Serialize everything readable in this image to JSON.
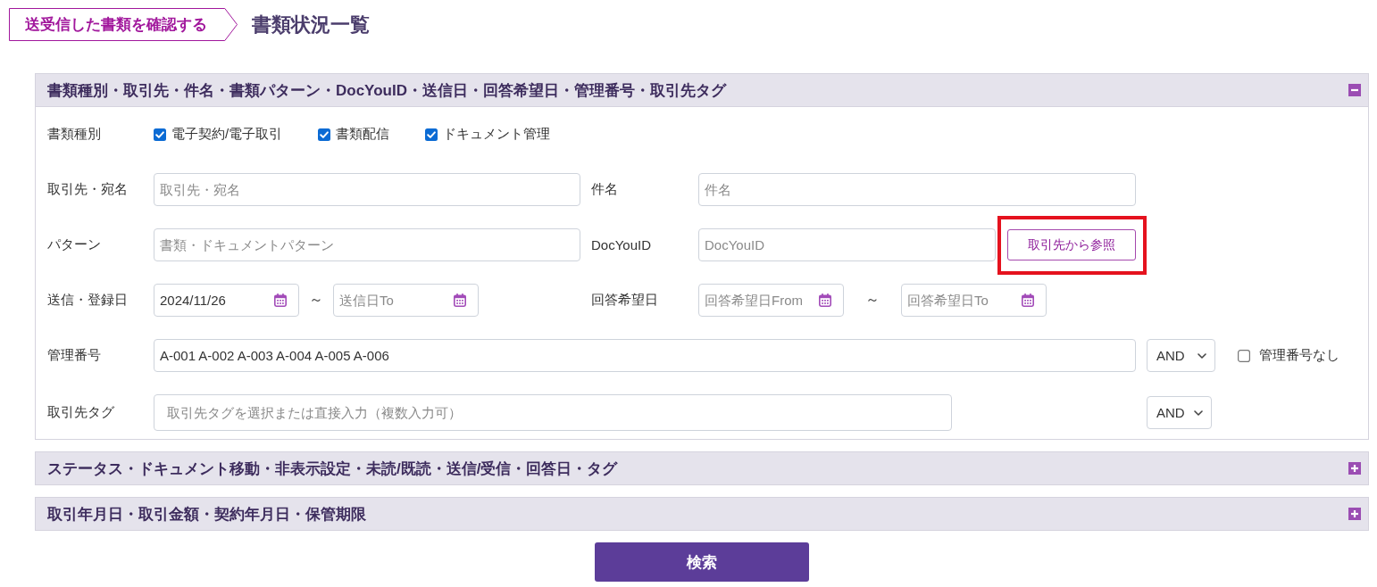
{
  "breadcrumb": {
    "link": "送受信した書類を確認する",
    "title": "書類状況一覧"
  },
  "sections": [
    {
      "title": "書類種別・取引先・件名・書類パターン・DocYouID・送信日・回答希望日・管理番号・取引先タグ",
      "expanded": true,
      "rows": [
        {
          "kind": "checkboxes",
          "label": "書類種別",
          "options": [
            {
              "label": "電子契約/電子取引",
              "checked": true
            },
            {
              "label": "書類配信",
              "checked": true
            },
            {
              "label": "ドキュメント管理",
              "checked": true
            }
          ]
        },
        {
          "kind": "pair",
          "items": [
            {
              "label": "取引先・宛名",
              "placeholder": "取引先・宛名"
            },
            {
              "label": "件名",
              "placeholder": "件名"
            }
          ]
        },
        {
          "kind": "pair",
          "items": [
            {
              "label": "パターン",
              "placeholder": "書類・ドキュメントパターン"
            },
            {
              "label": "DocYouID",
              "placeholder": "DocYouID",
              "button": {
                "label": "取引先から参照",
                "highlighted": true
              }
            }
          ]
        },
        {
          "kind": "date_ranges",
          "items": [
            {
              "label": "送信・登録日",
              "from": {
                "value": "2024/11/26"
              },
              "separator": "～",
              "to": {
                "placeholder": "送信日To"
              }
            },
            {
              "label": "回答希望日",
              "from": {
                "placeholder": "回答希望日From"
              },
              "separator": "～",
              "to": {
                "placeholder": "回答希望日To"
              }
            }
          ]
        },
        {
          "kind": "text_operator",
          "label": "管理番号",
          "value": "A-001 A-002 A-003 A-004 A-005 A-006",
          "operator": "AND",
          "checkbox": {
            "label": "管理番号なし",
            "checked": false
          }
        },
        {
          "kind": "tags",
          "label": "取引先タグ",
          "placeholder": "取引先タグを選択または直接入力（複数入力可）",
          "operator": "AND"
        }
      ]
    },
    {
      "title": "ステータス・ドキュメント移動・非表示設定・未読/既読・送信/受信・回答日・タグ",
      "expanded": false
    },
    {
      "title": "取引年月日・取引金額・契約年月日・保管期限",
      "expanded": false
    }
  ],
  "search_button": "検索"
}
